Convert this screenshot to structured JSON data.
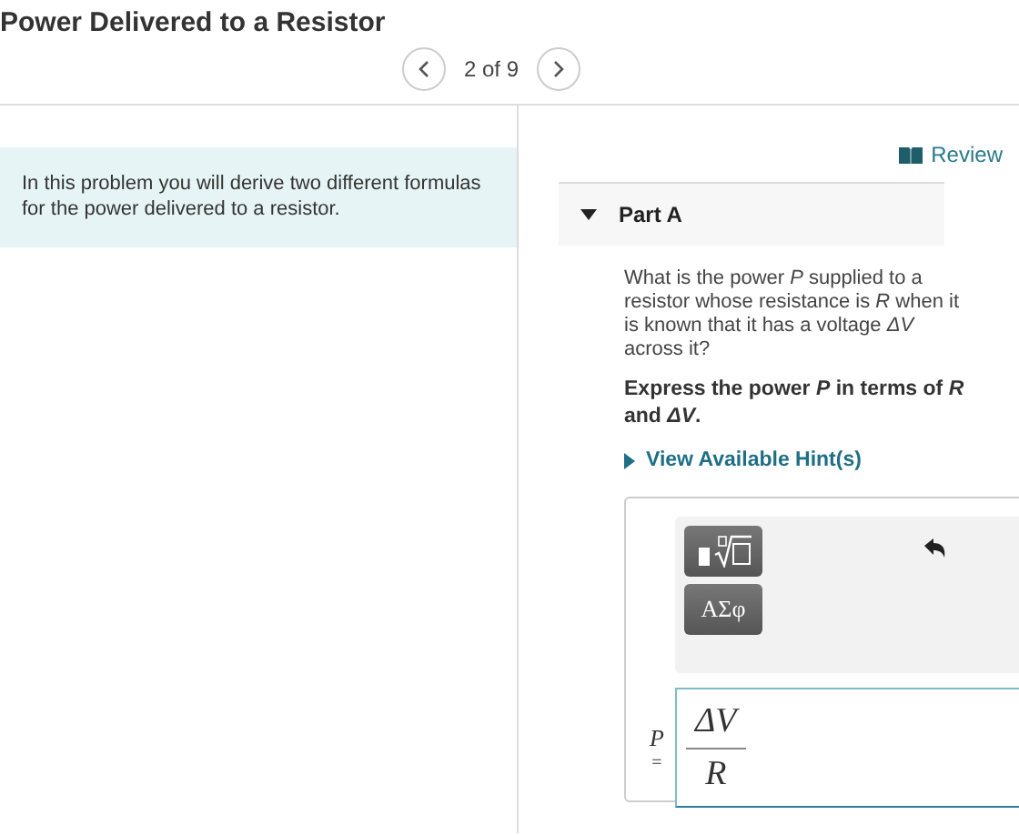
{
  "header": {
    "title": "Power Delivered to a Resistor",
    "pager": "2 of 9"
  },
  "intro": "In this problem you will derive two different formulas for the power delivered to a resistor.",
  "review_link": "Review",
  "part": {
    "title": "Part A",
    "expanded": true,
    "question": "What is the power *P* supplied to a resistor whose resistance is *R* when it is known that it has a voltage *ΔV* across it?",
    "instruction": "Express the power *P* in terms of *R* and *ΔV*.",
    "hint": {
      "label": "View Available Hint(s)",
      "expanded": false
    }
  },
  "answer": {
    "toolbar_buttons": [
      {
        "kind": "templates"
      },
      {
        "kind": "greek",
        "label": "AΣφ"
      }
    ],
    "variable": "P",
    "equals": "=",
    "numerator": "ΔV",
    "denominator": "R"
  }
}
